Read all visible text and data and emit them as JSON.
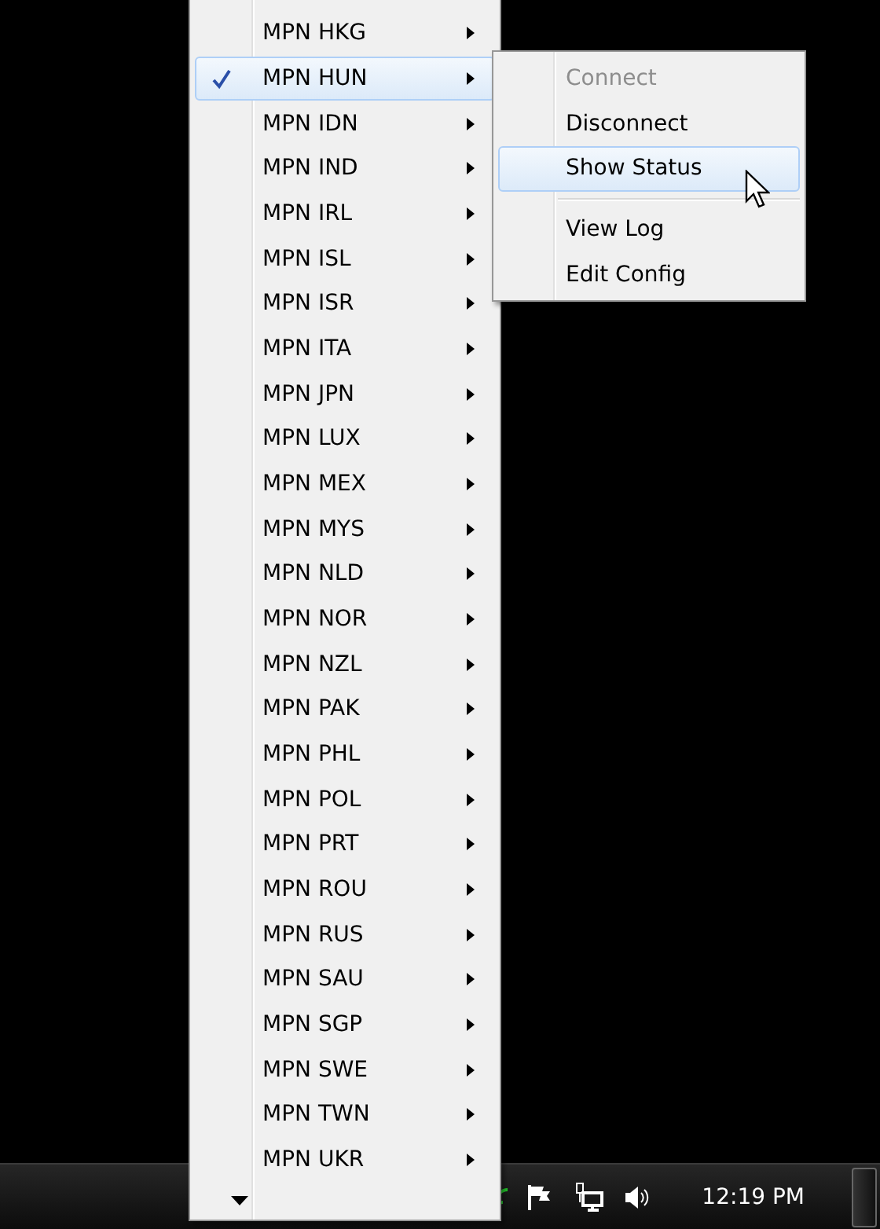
{
  "menu": {
    "items": [
      {
        "label": "MPN HKG",
        "checked": false,
        "selected": false
      },
      {
        "label": "MPN HUN",
        "checked": true,
        "selected": true
      },
      {
        "label": "MPN IDN",
        "checked": false,
        "selected": false
      },
      {
        "label": "MPN IND",
        "checked": false,
        "selected": false
      },
      {
        "label": "MPN IRL",
        "checked": false,
        "selected": false
      },
      {
        "label": "MPN ISL",
        "checked": false,
        "selected": false
      },
      {
        "label": "MPN ISR",
        "checked": false,
        "selected": false
      },
      {
        "label": "MPN ITA",
        "checked": false,
        "selected": false
      },
      {
        "label": "MPN JPN",
        "checked": false,
        "selected": false
      },
      {
        "label": "MPN LUX",
        "checked": false,
        "selected": false
      },
      {
        "label": "MPN MEX",
        "checked": false,
        "selected": false
      },
      {
        "label": "MPN MYS",
        "checked": false,
        "selected": false
      },
      {
        "label": "MPN NLD",
        "checked": false,
        "selected": false
      },
      {
        "label": "MPN NOR",
        "checked": false,
        "selected": false
      },
      {
        "label": "MPN NZL",
        "checked": false,
        "selected": false
      },
      {
        "label": "MPN PAK",
        "checked": false,
        "selected": false
      },
      {
        "label": "MPN PHL",
        "checked": false,
        "selected": false
      },
      {
        "label": "MPN POL",
        "checked": false,
        "selected": false
      },
      {
        "label": "MPN PRT",
        "checked": false,
        "selected": false
      },
      {
        "label": "MPN ROU",
        "checked": false,
        "selected": false
      },
      {
        "label": "MPN RUS",
        "checked": false,
        "selected": false
      },
      {
        "label": "MPN SAU",
        "checked": false,
        "selected": false
      },
      {
        "label": "MPN SGP",
        "checked": false,
        "selected": false
      },
      {
        "label": "MPN SWE",
        "checked": false,
        "selected": false
      },
      {
        "label": "MPN TWN",
        "checked": false,
        "selected": false
      },
      {
        "label": "MPN UKR",
        "checked": false,
        "selected": false
      }
    ]
  },
  "submenu": {
    "items": [
      {
        "kind": "item",
        "label": "Connect",
        "disabled": true,
        "selected": false
      },
      {
        "kind": "item",
        "label": "Disconnect",
        "disabled": false,
        "selected": false
      },
      {
        "kind": "item",
        "label": "Show Status",
        "disabled": false,
        "selected": true
      },
      {
        "kind": "separator"
      },
      {
        "kind": "item",
        "label": "View Log",
        "disabled": false,
        "selected": false
      },
      {
        "kind": "item",
        "label": "Edit Config",
        "disabled": false,
        "selected": false
      }
    ]
  },
  "taskbar": {
    "clock": "12:19 PM"
  }
}
